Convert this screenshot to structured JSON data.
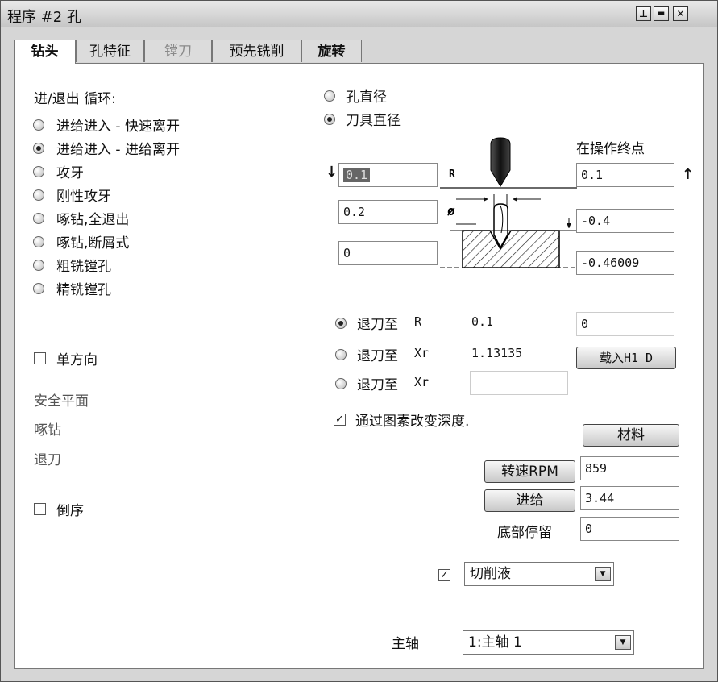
{
  "window": {
    "title": "程序 #2 孔"
  },
  "tabs": [
    {
      "label": "钻头",
      "state": "active"
    },
    {
      "label": "孔特征",
      "state": "normal"
    },
    {
      "label": "镗刀",
      "state": "disabled"
    },
    {
      "label": "预先铣削",
      "state": "normal"
    },
    {
      "label": "旋转",
      "state": "normal"
    }
  ],
  "cycle": {
    "heading": "进/退出 循环:",
    "options": [
      {
        "label": "进给进入 - 快速离开",
        "selected": false
      },
      {
        "label": "进给进入 - 进给离开",
        "selected": true
      },
      {
        "label": "攻牙",
        "selected": false
      },
      {
        "label": "刚性攻牙",
        "selected": false
      },
      {
        "label": "啄钻,全退出",
        "selected": false
      },
      {
        "label": "啄钻,断屑式",
        "selected": false
      },
      {
        "label": "粗铣镗孔",
        "selected": false
      },
      {
        "label": "精铣镗孔",
        "selected": false
      }
    ]
  },
  "one_way": {
    "label": "单方向",
    "checked": false
  },
  "left_labels": {
    "safe_plane": "安全平面",
    "peck": "啄钻",
    "retract": "退刀"
  },
  "reverse": {
    "label": "倒序",
    "checked": false
  },
  "diameter_mode": {
    "options": [
      {
        "label": "孔直径",
        "selected": false
      },
      {
        "label": "刀具直径",
        "selected": true
      }
    ]
  },
  "diagram": {
    "end_label": "在操作终点",
    "r_label": "R",
    "dia_label": "ø",
    "left_values": [
      "0.1",
      "0.2",
      "0"
    ],
    "right_values": [
      "0.1",
      "-0.4",
      "-0.46009"
    ]
  },
  "retract_to": {
    "options": [
      {
        "label": "退刀至",
        "code": "R",
        "value": "0.1",
        "selected": true
      },
      {
        "label": "退刀至",
        "code": "Xr",
        "value": "1.13135",
        "selected": false
      },
      {
        "label": "退刀至",
        "code": "Xr",
        "value": "",
        "selected": false
      }
    ],
    "field_value": "0",
    "load_button": "载入H1 D"
  },
  "change_depth": {
    "label": "通过图素改变深度.",
    "checked": true
  },
  "material_button": "材料",
  "speed": {
    "button": "转速RPM",
    "value": "859"
  },
  "feed": {
    "button": "进给",
    "value": "3.44"
  },
  "dwell": {
    "label": "底部停留",
    "value": "0"
  },
  "coolant": {
    "checked": true,
    "value": "切削液"
  },
  "spindle": {
    "label": "主轴",
    "value": "1:主轴 1"
  },
  "icons": {
    "restore": "pin-icon",
    "minimize": "minimize-icon",
    "close": "close-icon"
  }
}
